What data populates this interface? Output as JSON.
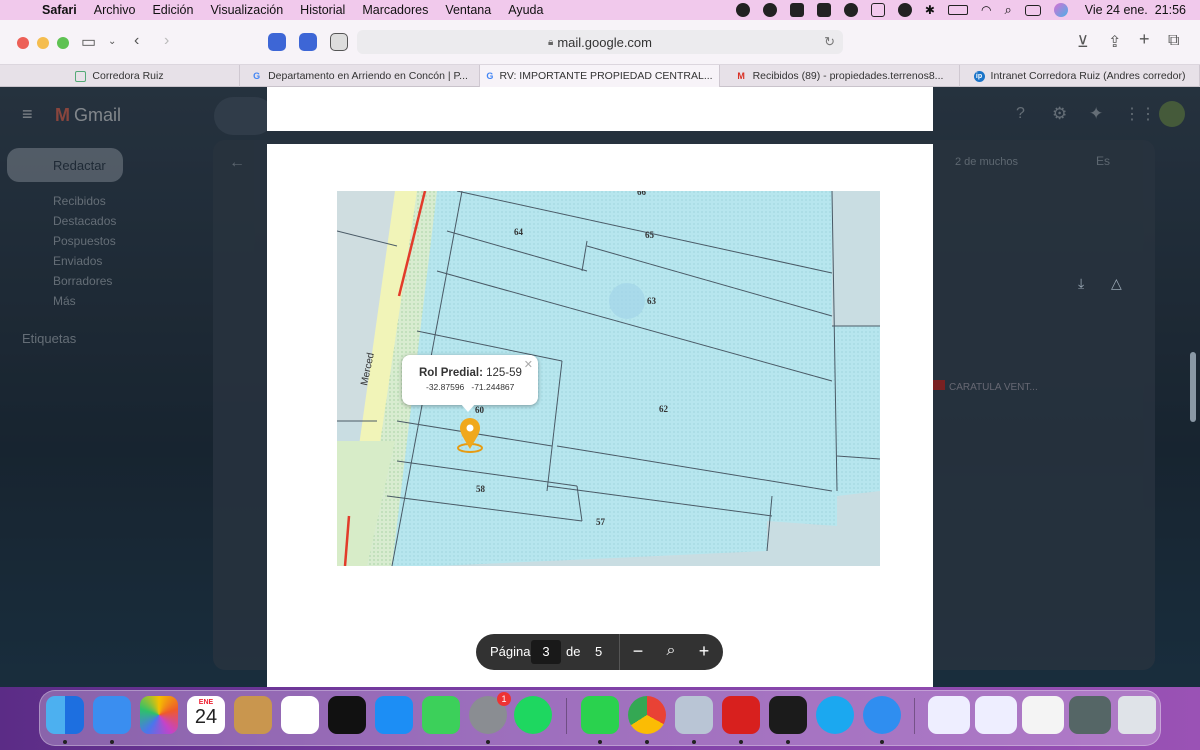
{
  "menubar": {
    "items": [
      "Safari",
      "Archivo",
      "Edición",
      "Visualización",
      "Historial",
      "Marcadores",
      "Ventana",
      "Ayuda"
    ],
    "datetime": "Vie 24 ene.  21:56"
  },
  "safari": {
    "url": "mail.google.com",
    "tabs": [
      {
        "label": "Corredora Ruiz",
        "icon": "corredora-favicon"
      },
      {
        "label": "Departamento en Arriendo en Concón | P...",
        "icon": "google-favicon"
      },
      {
        "label": "RV: IMPORTANTE PROPIEDAD CENTRAL...",
        "icon": "google-favicon",
        "active": true
      },
      {
        "label": "Recibidos (89) - propiedades.terrenos8...",
        "icon": "gmail-favicon"
      },
      {
        "label": "Intranet Corredora Ruiz (Andres corredor)",
        "icon": "intranet-favicon"
      }
    ]
  },
  "gmail": {
    "logo": "Gmail",
    "compose": "Redactar",
    "nav": [
      "Recibidos",
      "Destacados",
      "Pospuestos",
      "Enviados",
      "Borradores",
      "Más"
    ],
    "labels_title": "Etiquetas",
    "pagination": "2 de muchos",
    "lang": "Es",
    "attachment": "CARATULA VENT..."
  },
  "map": {
    "street": "Merced",
    "lots": [
      "66",
      "64",
      "65",
      "63",
      "62",
      "58",
      "57",
      "60"
    ],
    "popup": {
      "title": "Rol Predial:",
      "value": "125-59",
      "coords": "-32.87596   -71.244867"
    }
  },
  "pdf_viewer": {
    "page_label": "Página",
    "current_page": "3",
    "of_label": "de",
    "total_pages": "5"
  },
  "dock": {
    "calendar_month": "ENE",
    "calendar_day": "24",
    "settings_badge": "1"
  }
}
